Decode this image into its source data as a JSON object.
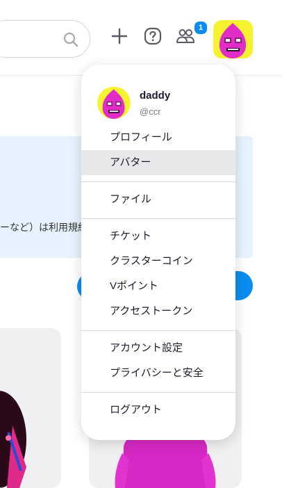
{
  "header": {
    "notification_count": "1"
  },
  "background": {
    "banner_text": "ーなど）は利用規約"
  },
  "menu": {
    "user_name": "daddy",
    "user_handle": "@ccr",
    "items": [
      {
        "label": "プロフィール"
      },
      {
        "label": "アバター"
      },
      {
        "label": "ファイル"
      },
      {
        "label": "チケット"
      },
      {
        "label": "クラスターコイン"
      },
      {
        "label": "Vポイント"
      },
      {
        "label": "アクセストークン"
      },
      {
        "label": "アカウント設定"
      },
      {
        "label": "プライバシーと安全"
      },
      {
        "label": "ログアウト"
      }
    ]
  },
  "colors": {
    "accent": "#0a8cf0",
    "banner_bg": "#e6f2fd",
    "avatar_bg": "#f7f230",
    "avatar_char": "#e22cc8"
  }
}
